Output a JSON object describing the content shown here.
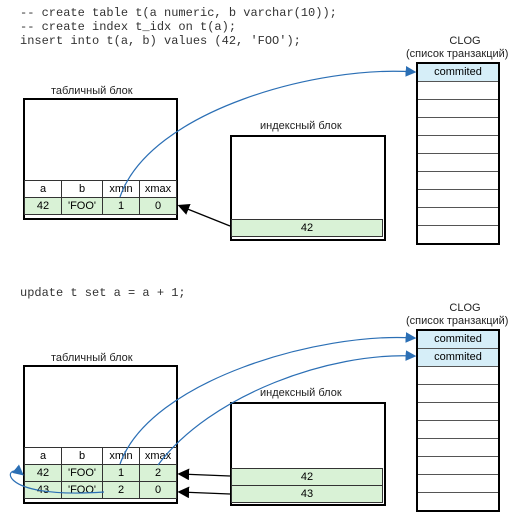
{
  "code": {
    "line1": "-- create table t(a numeric, b varchar(10));",
    "line2": "-- create index t_idx on t(a);",
    "line3": "insert into t(a, b) values (42, 'FOO');",
    "line4": "update t set a = a + 1;"
  },
  "labels": {
    "table_block": "табличный блок",
    "index_block": "индексный блок",
    "clog_title": "CLOG",
    "clog_sub": "(список транзакций)"
  },
  "headers": {
    "a": "a",
    "b": "b",
    "xmin": "xmin",
    "xmax": "xmax"
  },
  "top": {
    "rows": [
      {
        "a": "42",
        "b": "'FOO'",
        "xmin": "1",
        "xmax": "0"
      }
    ],
    "index": [
      "42"
    ],
    "clog": [
      "commited"
    ]
  },
  "bottom": {
    "rows": [
      {
        "a": "42",
        "b": "'FOO'",
        "xmin": "1",
        "xmax": "2"
      },
      {
        "a": "43",
        "b": "'FOO'",
        "xmin": "2",
        "xmax": "0"
      }
    ],
    "index": [
      "42",
      "43"
    ],
    "clog": [
      "commited",
      "commited"
    ]
  }
}
